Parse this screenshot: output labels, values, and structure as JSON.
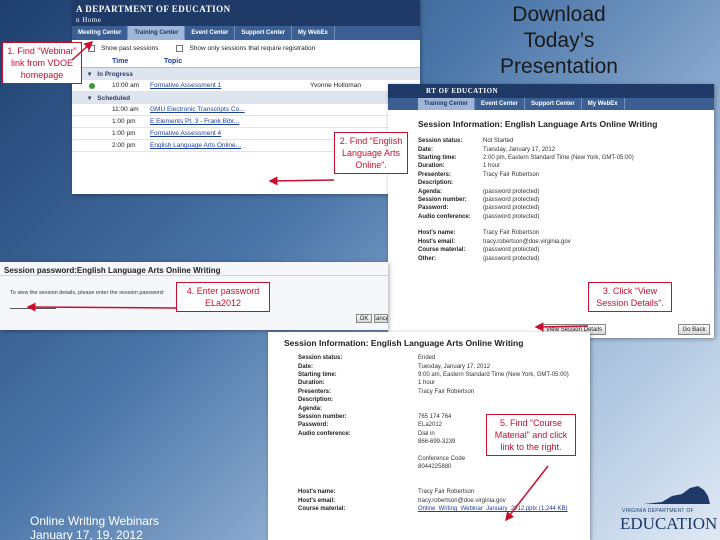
{
  "slide_title": "Download Today’s Presentation",
  "footer": {
    "line1": "Online Writing Webinars",
    "line2": "January 17, 19, 2012"
  },
  "callouts": {
    "c1": "1. Find “Webinar” link from VDOE homepage",
    "c2": "2. Find “English Language Arts Online”.",
    "c3": "3. Click “View Session Details”.",
    "c4": "4. Enter password ELa2012",
    "c5": "5. Find “Course Material” and click link to the right."
  },
  "screen1": {
    "brand": "A DEPARTMENT OF EDUCATION",
    "subtitle": "n Home",
    "nav": [
      "Meeting Center",
      "Training Center",
      "Event Center",
      "Support Center",
      "My WebEx"
    ],
    "filter1": "Show past sessions",
    "filter2": "Show only sessions that require registration",
    "col_time": "Time",
    "col_topic": "Topic",
    "in_progress": "In Progress",
    "scheduled": "Scheduled",
    "sessions": [
      {
        "time": "10:00 am",
        "topic": "Formative Assessment 1",
        "host": "Yvonne Holloman"
      },
      {
        "time": "11:00 am",
        "topic": "GMU Electronic Transcripts Co...",
        "host": ""
      },
      {
        "time": "1:00 pm",
        "topic": "E Elements Pt. 3 - Frank Bibr...",
        "host": ""
      },
      {
        "time": "1:00 pm",
        "topic": "Formative Assessment 4",
        "host": ""
      },
      {
        "time": "2:00 pm",
        "topic": "English Language Arts Online...",
        "host": ""
      }
    ]
  },
  "screen2": {
    "brand": "RT OF EDUCATION",
    "nav": [
      "Training Center",
      "Event Center",
      "Support Center",
      "My WebEx"
    ],
    "title": "Session Information: English Language Arts Online Writing",
    "rows": [
      [
        "Session status:",
        "Not Started"
      ],
      [
        "Date:",
        "Tuesday, January 17, 2012"
      ],
      [
        "Starting time:",
        "2:00 pm, Eastern Standard Time (New York, GMT-05:00)"
      ],
      [
        "Duration:",
        "1 hour"
      ],
      [
        "Presenters:",
        "Tracy Fair Robertson"
      ],
      [
        "Description:",
        ""
      ],
      [
        "Agenda:",
        "(password protected)"
      ],
      [
        "Session number:",
        "(password protected)"
      ],
      [
        "Password:",
        "(password protected)"
      ],
      [
        "Audio conference:",
        "(password protected)"
      ],
      [
        "",
        ""
      ],
      [
        "Host's name:",
        "Tracy Fair Robertson"
      ],
      [
        "Host's email:",
        "tracy.robertson@doe.virginia.gov"
      ],
      [
        "Course material:",
        "(password protected)"
      ],
      [
        "Other:",
        "(password protected)"
      ]
    ],
    "view_button": "View Session Details",
    "back_button": "Go Back"
  },
  "screen3": {
    "title": "Session password:English Language Arts Online Writing",
    "prompt": "To view the session details, please enter the session password:",
    "ok": "OK",
    "cancel": "Cancel"
  },
  "screen4": {
    "title": "Session Information: English Language Arts Online Writing",
    "rows": [
      [
        "Session status:",
        "Ended"
      ],
      [
        "Date:",
        "Tuesday, January 17, 2012"
      ],
      [
        "Starting time:",
        "9:00 am, Eastern Standard Time (New York, GMT-05:00)"
      ],
      [
        "Duration:",
        "1 hour"
      ],
      [
        "Presenters:",
        "Tracy Fair Robertson"
      ],
      [
        "Description:",
        ""
      ],
      [
        "Agenda:",
        ""
      ],
      [
        "Session number:",
        "765 174 764"
      ],
      [
        "Password:",
        "ELa2012"
      ],
      [
        "Audio conference:",
        "Dial in"
      ],
      [
        "",
        "866-699-3239"
      ],
      [
        "",
        ""
      ],
      [
        "",
        "Conference Code"
      ],
      [
        "",
        "8044225880"
      ],
      [
        "",
        ""
      ],
      [
        "",
        ""
      ],
      [
        "Host's name:",
        "Tracy Fair Robertson"
      ],
      [
        "Host's email:",
        "tracy.robertson@doe.virginia.gov"
      ],
      [
        "Course material:",
        "Online_Writing_Webinar_January_2012.pptx (1,244 KB)"
      ]
    ]
  },
  "logo": {
    "line1": "VIRGINIA DEPARTMENT OF",
    "line2": "EDUCATION"
  },
  "colors": {
    "callout": "#c8102e",
    "doe_blue": "#1f3a66",
    "link": "#1b3f9e"
  }
}
